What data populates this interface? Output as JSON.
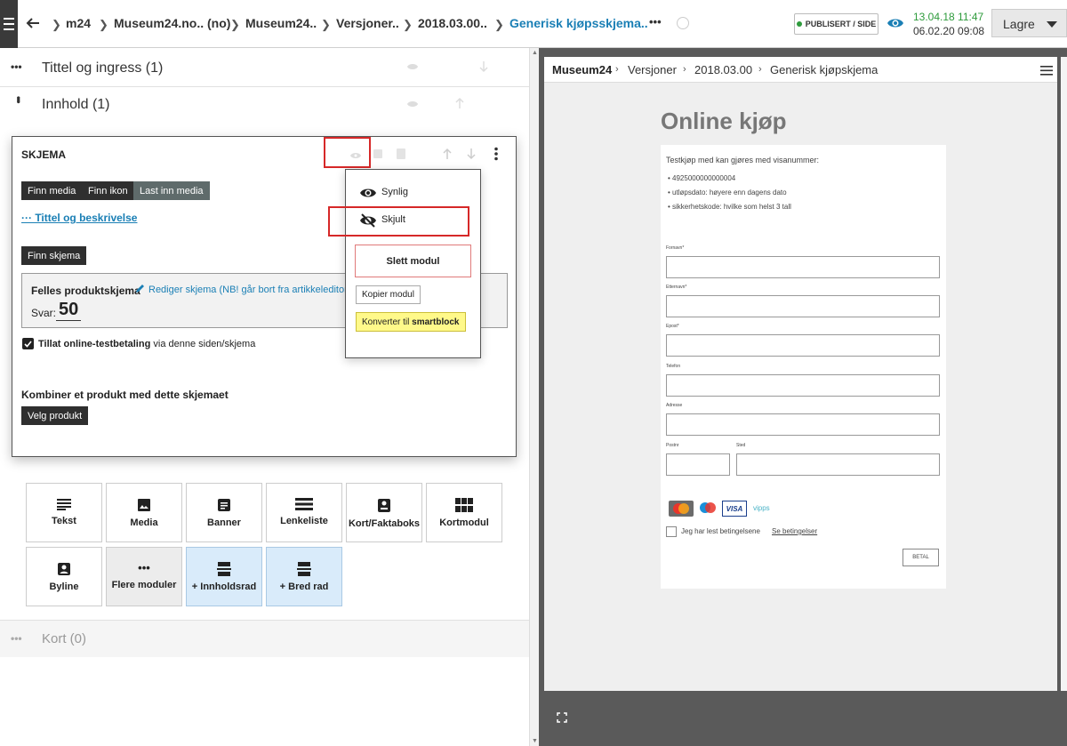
{
  "topbar": {
    "breadcrumbs": [
      "m24",
      "Museum24.no.. (no)",
      "Museum24..",
      "Versjoner..",
      "2018.03.00..",
      "Generisk kjøpsskjema.."
    ],
    "more": "•••",
    "publish_badge": "PUBLISERT / SIDE",
    "time_published": "13.04.18 11:47",
    "time_saved": "06.02.20 09:08",
    "save_label": "Lagre"
  },
  "sections": {
    "tittel": "Tittel og ingress (1)",
    "innhold": "Innhold (1)",
    "kort": "Kort (0)"
  },
  "module": {
    "title": "SKJEMA",
    "btn_finn_media": "Finn media",
    "btn_finn_ikon": "Finn ikon",
    "btn_last_inn": "Last inn media",
    "link_tittel": "··· Tittel og beskrivelse",
    "btn_finn_skjema": "Finn skjema",
    "felles_title": "Felles produktskjema",
    "felles_link": "Rediger skjema (NB! går bort fra artikkeleditor)",
    "svar_label": "Svar:",
    "svar_value": "50",
    "checkbox_bold": "Tillat online-testbetaling",
    "checkbox_rest": " via denne siden/skjema",
    "kombiner": "Kombiner et produkt med dette skjemaet",
    "btn_velg": "Velg produkt"
  },
  "popup": {
    "synlig": "Synlig",
    "skjult": "Skjult",
    "slett": "Slett modul",
    "kopier": "Kopier modul",
    "konverter_prefix": "Konverter til ",
    "konverter_bold": "smartblock"
  },
  "module_buttons": [
    "Tekst",
    "Media",
    "Banner",
    "Lenkeliste",
    "Kort/Faktaboks",
    "Kortmodul",
    "Byline",
    "Flere moduler",
    "+ Innholdsrad",
    "+ Bred rad"
  ],
  "preview": {
    "nav": [
      "Museum24",
      "Versjoner",
      "2018.03.00",
      "Generisk kjøpskjema"
    ],
    "heading": "Online kjøp",
    "intro": "Testkjøp med kan gjøres med visanummer:",
    "bullets": [
      "4925000000000004",
      "utløpsdato: høyere enn dagens dato",
      "sikkerhetskode: hvilke som helst 3 tall"
    ],
    "fields": [
      "Fornavn*",
      "Etternavn*",
      "Epost*",
      "Telefon",
      "Adresse"
    ],
    "postnr": "Postnr",
    "sted": "Sted",
    "payment_icons": [
      "mastercard",
      "maestro",
      "VISA",
      "vipps"
    ],
    "terms_text": "Jeg har lest betingelsene",
    "terms_link": "Se betingelser",
    "betal": "BETAL"
  },
  "colors": {
    "accent": "#1a7fb5",
    "published_green": "#2e9b3c",
    "highlight_red": "#d62828",
    "smartblock_yellow": "#fff98a"
  }
}
